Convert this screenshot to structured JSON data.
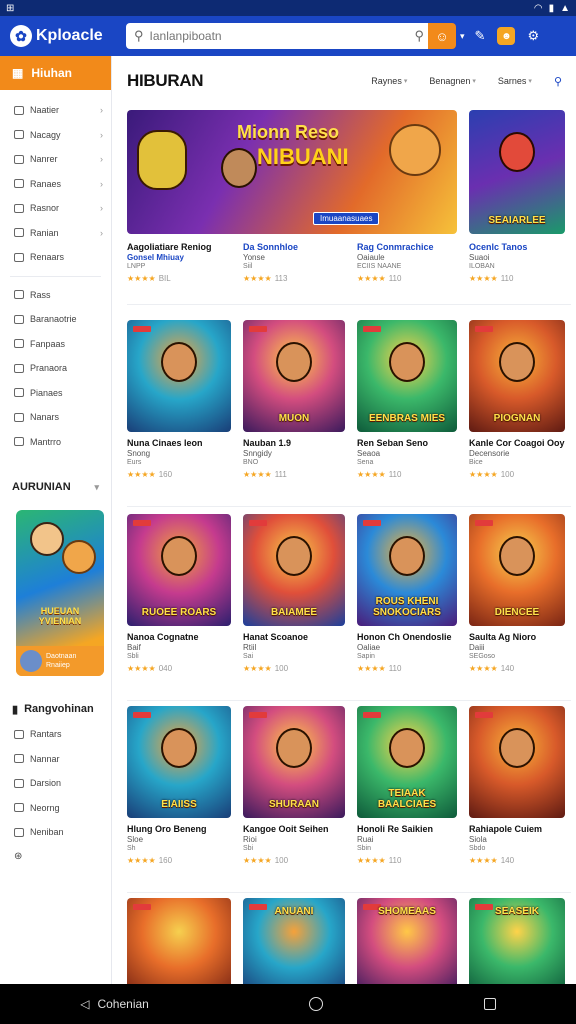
{
  "status_bar": {
    "left": "⊞",
    "icons": [
      "wifi-icon",
      "battery-icon",
      "signal-icon"
    ]
  },
  "header": {
    "app_name": "Kploacle",
    "search_placeholder": "Ianlanpiboatn",
    "header_icons": [
      "torch-icon",
      "coin-icon",
      "settings-icon"
    ]
  },
  "sidebar": {
    "active_label": "Hiuhan",
    "items": [
      {
        "label": "Naatier"
      },
      {
        "label": "Nacagy"
      },
      {
        "label": "Nanrer"
      },
      {
        "label": "Ranaes"
      },
      {
        "label": "Rasnor"
      },
      {
        "label": "Ranian"
      },
      {
        "label": "Renaars"
      },
      {
        "label": "Rass"
      },
      {
        "label": "Baranaotrie"
      },
      {
        "label": "Fanpaas"
      },
      {
        "label": "Pranaora"
      },
      {
        "label": "Pianaes"
      },
      {
        "label": "Nanars"
      },
      {
        "label": "Mantrro"
      }
    ],
    "section_heading": "AURUNIAN",
    "promo": {
      "title": "HUEUAN YVIENIAN",
      "caption_line1": "Daotnaan",
      "caption_line2": "Rnaiiep"
    },
    "section2_heading": "Rangvohinan",
    "items2": [
      {
        "label": "Rantars"
      },
      {
        "label": "Nannar"
      },
      {
        "label": "Darsion"
      },
      {
        "label": "Neorng"
      },
      {
        "label": "Neniban"
      }
    ]
  },
  "main": {
    "title": "HIBURAN",
    "tabs": [
      "Raynes",
      "Benagnen",
      "Sarnes"
    ],
    "banner": {
      "line1": "Mionn Reso",
      "line2": "NIBUANI",
      "button": "Imuaanasuaes"
    },
    "rows": [
      [
        {
          "title": "Aagoliatiare Reniog",
          "sub": "Gonsel Mhiuay",
          "sub2": "LNPP",
          "rating": "★★★★",
          "count": "BIL"
        },
        {
          "title": "Da Sonnhloe",
          "sub": "Yonse",
          "sub2": "Siil",
          "rating": "★★★★",
          "count": "113"
        },
        {
          "title": "Rag Conmrachice",
          "sub": "Oaiaule",
          "sub2": "ECIIS NAANE",
          "rating": "★★★★",
          "count": "110"
        },
        {
          "title": "Ocenlc Tanos",
          "sub": "Suaoi",
          "sub2": "ILOBAN",
          "rating": "★★★★",
          "count": "110"
        }
      ],
      [
        {
          "title": "Nuna Cinaes leon",
          "sub": "Snong",
          "sub2": "Eurs",
          "rating": "★★★★",
          "count": "160"
        },
        {
          "title": "Nauban 1.9",
          "sub": "Snngidy",
          "sub2": "BNO",
          "rating": "★★★★",
          "count": "111"
        },
        {
          "title": "Ren Seban Seno",
          "sub": "Seaoa",
          "sub2": "Sena",
          "rating": "★★★★",
          "count": "110"
        },
        {
          "title": "Kanle Cor Coagoi Ooy",
          "sub": "Decensorie",
          "sub2": "Bice",
          "rating": "★★★★",
          "count": "100"
        }
      ],
      [
        {
          "title": "Nanoa Cognatne",
          "sub": "Baif",
          "sub2": "Sbli",
          "rating": "★★★★",
          "count": "040"
        },
        {
          "title": "Hanat Scoanoe",
          "sub": "Rtiil",
          "sub2": "Sai",
          "rating": "★★★★",
          "count": "100"
        },
        {
          "title": "Honon Ch Onendoslie",
          "sub": "Oaliae",
          "sub2": "Sapin",
          "rating": "★★★★",
          "count": "110"
        },
        {
          "title": "Saulta Ag Nioro",
          "sub": "Daiii",
          "sub2": "SEGoso",
          "rating": "★★★★",
          "count": "140"
        }
      ],
      [
        {
          "title": "Hlung Oro Beneng",
          "sub": "Sloe",
          "sub2": "Sh",
          "rating": "★★★★",
          "count": "160"
        },
        {
          "title": "Kangoe Ooit Seihen",
          "sub": "Rioi",
          "sub2": "Sbi",
          "rating": "★★★★",
          "count": "100"
        },
        {
          "title": "Honoli Re Saikien",
          "sub": "Ruai",
          "sub2": "Sbin",
          "rating": "★★★★",
          "count": "110"
        },
        {
          "title": "Rahiapole Cuiem",
          "sub": "Siola",
          "sub2": "Sbdo",
          "rating": "★★★★",
          "count": "140"
        }
      ]
    ],
    "thumb_labels": [
      [
        "",
        "",
        "",
        "SEAIARLEE"
      ],
      [
        "",
        "MUON",
        "EENBRAS MIES",
        "PIOGNAN"
      ],
      [
        "RUOEE ROARS",
        "BAIAMEE",
        "ROUS KHENI SNOKOCIARS",
        "DIENCEE"
      ],
      [
        "EIAIISS",
        "SHURAAN",
        "TEIAAK BAALCIAES",
        ""
      ],
      [
        "",
        "ANUANI",
        "SHOMEAAS",
        "SEASEIK"
      ]
    ]
  },
  "navbar": {
    "back_label": "Cohenian"
  }
}
